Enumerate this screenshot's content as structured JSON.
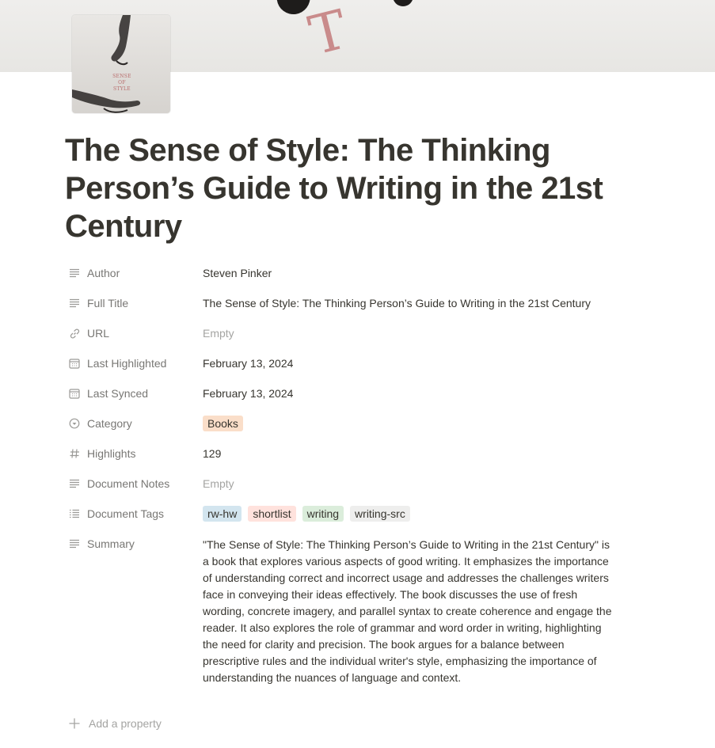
{
  "cover": {
    "art_letter": "T"
  },
  "book_icon": {
    "cover_text": "SENSE OF STYLE"
  },
  "title": "The Sense of Style: The Thinking Person’s Guide to Writing in the 21st Century",
  "properties": [
    {
      "label": "Author",
      "icon": "text-lines-icon",
      "value": "Steven Pinker"
    },
    {
      "label": "Full Title",
      "icon": "text-lines-icon",
      "value": "The Sense of Style: The Thinking Person’s Guide to Writing in the 21st Century"
    },
    {
      "label": "URL",
      "icon": "link-icon",
      "value": "Empty"
    },
    {
      "label": "Last Highlighted",
      "icon": "calendar-icon",
      "value": "February 13, 2024"
    },
    {
      "label": "Last Synced",
      "icon": "calendar-icon",
      "value": "February 13, 2024"
    },
    {
      "label": "Category",
      "icon": "select-icon",
      "value": "Books",
      "tag_color": "#fadec9"
    },
    {
      "label": "Highlights",
      "icon": "hash-icon",
      "value": "129"
    },
    {
      "label": "Document Notes",
      "icon": "text-lines-icon",
      "value": "Empty"
    },
    {
      "label": "Document Tags",
      "icon": "list-icon",
      "tags": [
        {
          "name": "rw-hw",
          "color": "#d3e5ef"
        },
        {
          "name": "shortlist",
          "color": "#ffe2dd"
        },
        {
          "name": "writing",
          "color": "#dbeddb"
        },
        {
          "name": "writing-src",
          "color": "#eeeeed"
        }
      ]
    },
    {
      "label": "Summary",
      "icon": "text-lines-icon",
      "value": "\"The Sense of Style: The Thinking Person’s Guide to Writing in the 21st Century\" is a book that explores various aspects of good writing. It emphasizes the importance of understanding correct and incorrect usage and addresses the challenges writers face in conveying their ideas effectively. The book discusses the use of fresh wording, concrete imagery, and parallel syntax to create coherence and engage the reader. It also explores the role of grammar and word order in writing, highlighting the need for clarity and precision. The book argues for a balance between prescriptive rules and the individual writer's style, emphasizing the importance of understanding the nuances of language and context."
    }
  ],
  "add_property": "Add a property",
  "colors": {
    "text": "#37352f",
    "muted": "#787774",
    "placeholder": "#a4a4a2"
  }
}
